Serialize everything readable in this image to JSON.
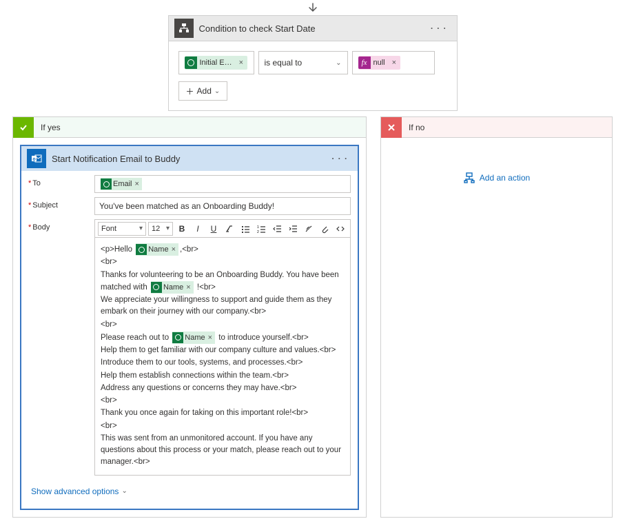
{
  "arrow": true,
  "condition": {
    "title": "Condition to check Start Date",
    "left_token": "Initial E…",
    "operator": "is equal to",
    "right_token_label": "null",
    "right_token_fx": "fx",
    "add_label": "Add"
  },
  "branches": {
    "yes_label": "If yes",
    "no_label": "If no",
    "add_action_label": "Add an action"
  },
  "action": {
    "title": "Start Notification Email to Buddy",
    "labels": {
      "to": "To",
      "subject": "Subject",
      "body": "Body"
    },
    "to_token": "Email",
    "subject_value": "You've been matched as an Onboarding Buddy!",
    "font_label": "Font",
    "size_label": "12",
    "body_lines": [
      "&lt;p&gt;Hello {NAME},&lt;br&gt;",
      "&lt;br&gt;",
      "Thanks for volunteering to be an Onboarding Buddy. You have been matched with {NAME} !&lt;br&gt;",
      "We appreciate your willingness to support and guide them as they embark on their journey with our company.&lt;br&gt;",
      "&lt;br&gt;",
      "Please reach out to {NAME} to introduce yourself.&lt;br&gt;",
      "Help them to get familiar with our company culture and values.&lt;br&gt;",
      "Introduce them to our tools, systems, and processes.&lt;br&gt;",
      "Help them establish connections within the team.&lt;br&gt;",
      "Address any questions or concerns they may have.&lt;br&gt;",
      "&lt;br&gt;",
      "Thank you once again for taking on this important role!&lt;br&gt;",
      "&lt;br&gt;",
      "This was sent from an unmonitored account. If you have any questions about this process or your match, please reach out to your manager.&lt;br&gt;"
    ],
    "name_token": "Name",
    "advanced": "Show advanced options"
  }
}
